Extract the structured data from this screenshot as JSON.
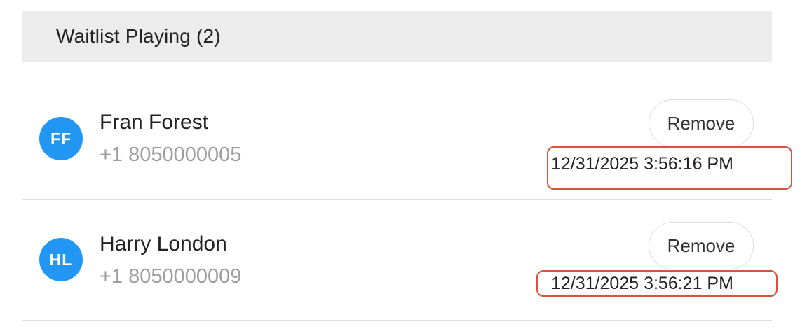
{
  "header": {
    "title": "Waitlist Playing (2)"
  },
  "entries": [
    {
      "initials": "FF",
      "name": "Fran Forest",
      "phone": "+1 8050000005",
      "remove_label": "Remove",
      "timestamp": "12/31/2025 3:56:16 PM"
    },
    {
      "initials": "HL",
      "name": "Harry London",
      "phone": "+1 8050000009",
      "remove_label": "Remove",
      "timestamp": "12/31/2025 3:56:21 PM"
    }
  ],
  "colors": {
    "avatar_bg": "#2196f3",
    "header_bg": "#ececec",
    "highlight_border": "#d5533f",
    "phone_text": "#9e9e9e"
  }
}
